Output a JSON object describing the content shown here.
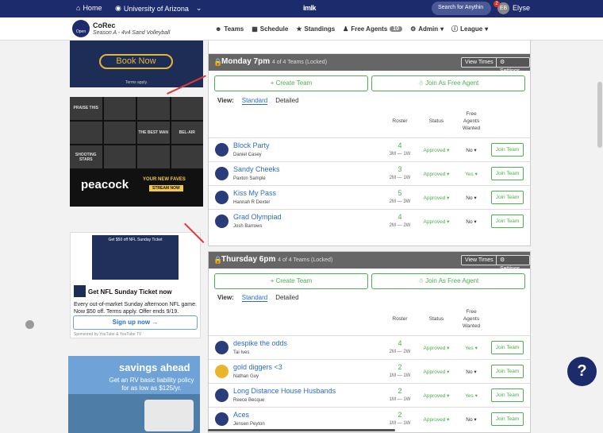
{
  "topbar": {
    "home": "Home",
    "school": "University of Arizona",
    "logo": "imlk",
    "search_placeholder": "Search for Anythin",
    "notif_count": "2",
    "avatar": "EB",
    "user": "Elyse"
  },
  "league": {
    "badge": "Open",
    "title": "CoRec",
    "subtitle": "Season A - 4v4 Sand Volleyball"
  },
  "nav": {
    "teams": "Teams",
    "schedule": "Schedule",
    "standings": "Standings",
    "free_agents": "Free Agents",
    "free_agents_count": "10",
    "admin": "Admin",
    "league": "League"
  },
  "ads": {
    "ad1_button": "Book Now",
    "ad1_terms": "Terms apply.",
    "ad2_tiles": [
      "PRAISE THIS",
      "",
      "",
      "",
      "",
      "",
      "THE BEST MAN",
      "BEL-AIR",
      "SHOOTING STARS",
      "",
      "",
      ""
    ],
    "ad2_brand": "peacock",
    "ad2_faves": "YOUR NEW FAVES",
    "ad2_cta": "STREAM NOW",
    "ad3_promo": "Get $50 off NFL Sunday Ticket",
    "ad3_headline": "Get NFL Sunday Ticket now",
    "ad3_body": "Every out-of-market Sunday afternoon NFL game. Now $50 off. Terms apply. Offer ends 9/19.",
    "ad3_signup": "Sign up now →",
    "ad3_sponsor": "Sponsored by YouTube & YouTube TV",
    "ad4_big": "savings ahead",
    "ad4_small": "Get an RV basic liability policy for as low as $125/yr."
  },
  "common": {
    "create_team": "+ Create Team",
    "join_free_agent": "☃ Join As Free Agent",
    "view_label": "View:",
    "standard": "Standard",
    "detailed": "Detailed",
    "col_roster": "Roster",
    "col_status": "Status",
    "col_free_agents": "Free Agents Wanted",
    "view_times": "View Times",
    "settings": "⚙ Settings",
    "join_team": "Join Team"
  },
  "panels": [
    {
      "title": "Monday 7pm",
      "sub": "4 of 4 Teams (Locked)",
      "teams": [
        {
          "name": "Block Party",
          "captain": "Daniel Casey",
          "roster": "4",
          "detail": "3M — 1W",
          "status": "Approved ▾",
          "fa": "No ▾"
        },
        {
          "name": "Sandy Cheeks",
          "captain": "Paxton Sample",
          "roster": "3",
          "detail": "2M — 1W",
          "status": "Approved ▾",
          "fa": "Yes ▾"
        },
        {
          "name": "Kiss My Pass",
          "captain": "Hannah R Dexter",
          "roster": "5",
          "detail": "2M — 3W",
          "status": "Approved ▾",
          "fa": "No ▾"
        },
        {
          "name": "Grad Olympiad",
          "captain": "Josh Barrows",
          "roster": "4",
          "detail": "2M — 2W",
          "status": "Approved ▾",
          "fa": "No ▾"
        }
      ]
    },
    {
      "title": "Thursday 6pm",
      "sub": "4 of 4 Teams (Locked)",
      "teams": [
        {
          "name": "despike the odds",
          "captain": "Tai Ives",
          "roster": "4",
          "detail": "2M — 2W",
          "status": "Approved ▾",
          "fa": "Yes ▾"
        },
        {
          "name": "gold diggers <3",
          "captain": "Nathan Guy",
          "roster": "2",
          "detail": "1M — 1W",
          "status": "Approved ▾",
          "fa": "No ▾"
        },
        {
          "name": "Long Distance House Husbands",
          "captain": "Reece Becque",
          "roster": "2",
          "detail": "1M — 1W",
          "status": "Approved ▾",
          "fa": "Yes ▾"
        },
        {
          "name": "Aces",
          "captain": "Jensen Peyton",
          "roster": "2",
          "detail": "1M — 1W",
          "status": "Approved ▾",
          "fa": "No ▾"
        }
      ]
    }
  ],
  "help": "?"
}
